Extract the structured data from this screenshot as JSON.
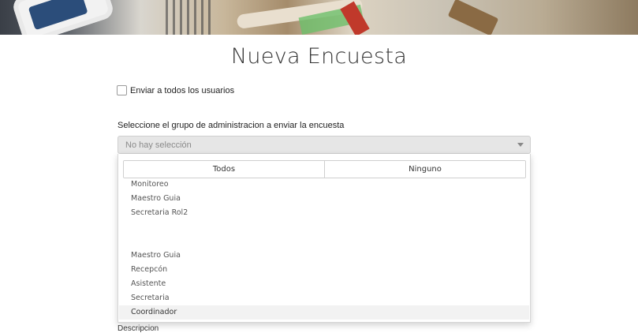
{
  "page": {
    "title": "Nueva Encuesta"
  },
  "send_all": {
    "label": "Enviar a todos los usuarios",
    "checked": false
  },
  "group_select": {
    "label": "Seleccione el grupo de administracion a enviar la encuesta",
    "placeholder": "No hay selección",
    "buttons": {
      "all": "Todos",
      "none": "Ninguno"
    },
    "options": [
      "Monitoreo",
      "Maestro Guia",
      "Secretaria Rol2",
      "Maestro Guia",
      "Recepcón",
      "Asistente",
      "Secretaria",
      "Coordinador"
    ],
    "highlighted": "Coordinador"
  },
  "partial_label": "Descripcion",
  "colors": {
    "banner_dark": "#3a3f47",
    "select_bg": "#e6e6e6",
    "hover_bg": "#f2f2f2"
  }
}
